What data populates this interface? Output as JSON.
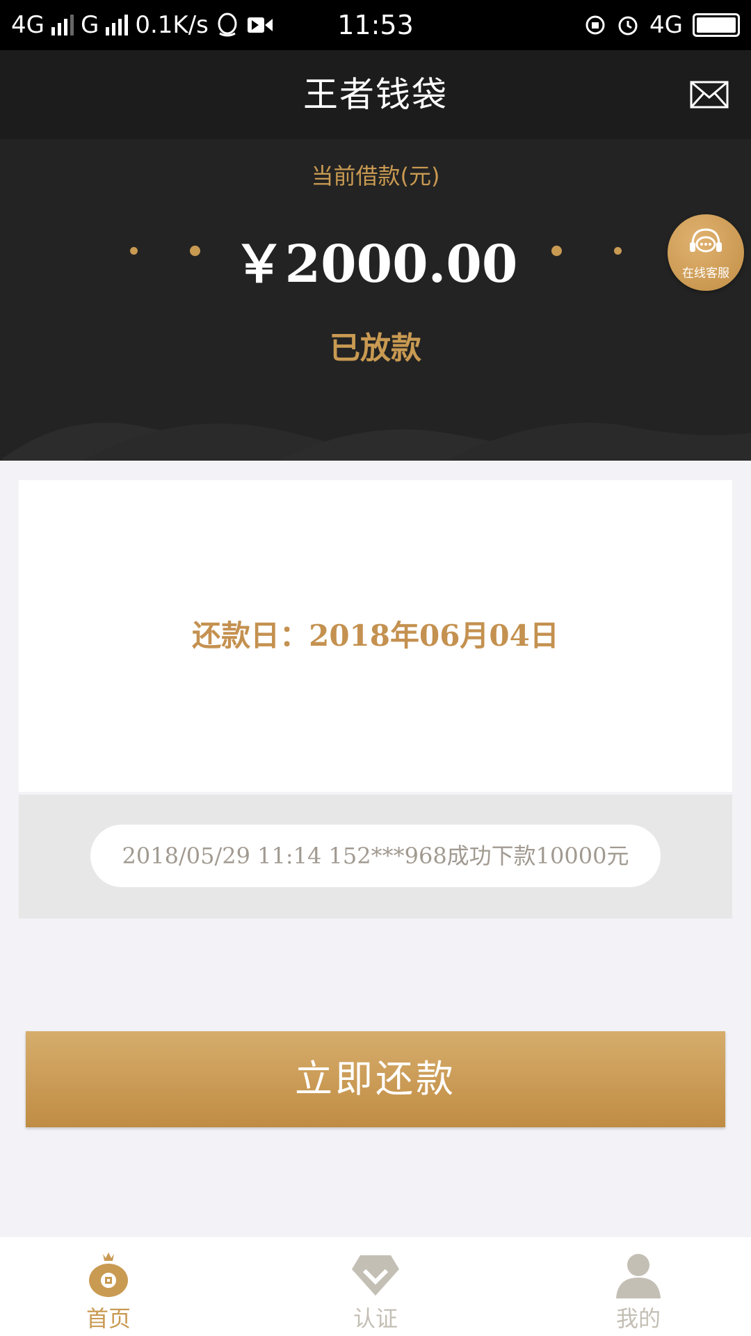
{
  "status_bar": {
    "network_1": "4G",
    "network_2": "G",
    "speed": "0.1K/s",
    "time": "11:53",
    "network_3": "4G"
  },
  "header": {
    "title": "王者钱袋",
    "mail_icon": "envelope-icon"
  },
  "loan": {
    "label": "当前借款(元)",
    "amount": "￥2000.00",
    "status": "已放款"
  },
  "service": {
    "label": "在线客服",
    "icon": "headset-chat-icon"
  },
  "repayment": {
    "due_date": "还款日：2018年06月04日"
  },
  "ticker": {
    "message": "2018/05/29 11:14 152***968成功下款10000元"
  },
  "actions": {
    "repay_label": "立即还款"
  },
  "tabs": [
    {
      "label": "首页",
      "icon": "money-bag-icon",
      "active": true
    },
    {
      "label": "认证",
      "icon": "diamond-icon",
      "active": false
    },
    {
      "label": "我的",
      "icon": "user-icon",
      "active": false
    }
  ],
  "colors": {
    "accent": "#c99a52",
    "dark_bg": "#232323",
    "inactive_tab": "#c4bfb5"
  }
}
